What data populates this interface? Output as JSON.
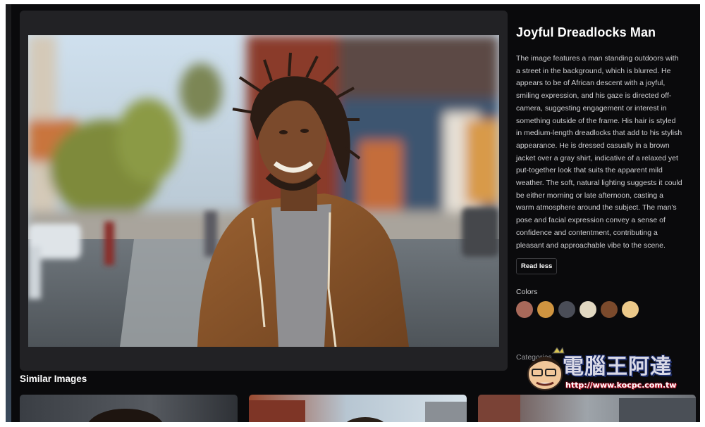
{
  "image": {
    "title": "Joyful Dreadlocks Man",
    "description": "The image features a man standing outdoors with a street in the background, which is blurred. He appears to be of African descent with a joyful, smiling expression, and his gaze is directed off-camera, suggesting engagement or interest in something outside of the frame. His hair is styled in medium-length dreadlocks that add to his stylish appearance. He is dressed casually in a brown jacket over a gray shirt, indicative of a relaxed yet put-together look that suits the apparent mild weather. The soft, natural lighting suggests it could be either morning or late afternoon, casting a warm atmosphere around the subject. The man's pose and facial expression convey a sense of confidence and contentment, contributing a pleasant and approachable vibe to the scene.",
    "read_less_label": "Read less"
  },
  "colors": {
    "label": "Colors",
    "swatches": [
      "#a8695a",
      "#cf9440",
      "#4a4d57",
      "#e2d8c2",
      "#7b4a2c",
      "#ecc98a"
    ]
  },
  "categories": {
    "label": "Categories"
  },
  "similar": {
    "heading": "Similar Images"
  },
  "watermark": {
    "text": "電腦王阿達",
    "url": "http://www.kocpc.com.tw"
  },
  "theme": {
    "background": "#0a0a0c",
    "panel": "#222225",
    "text": "#ffffff",
    "muted": "#cfcfd2"
  }
}
